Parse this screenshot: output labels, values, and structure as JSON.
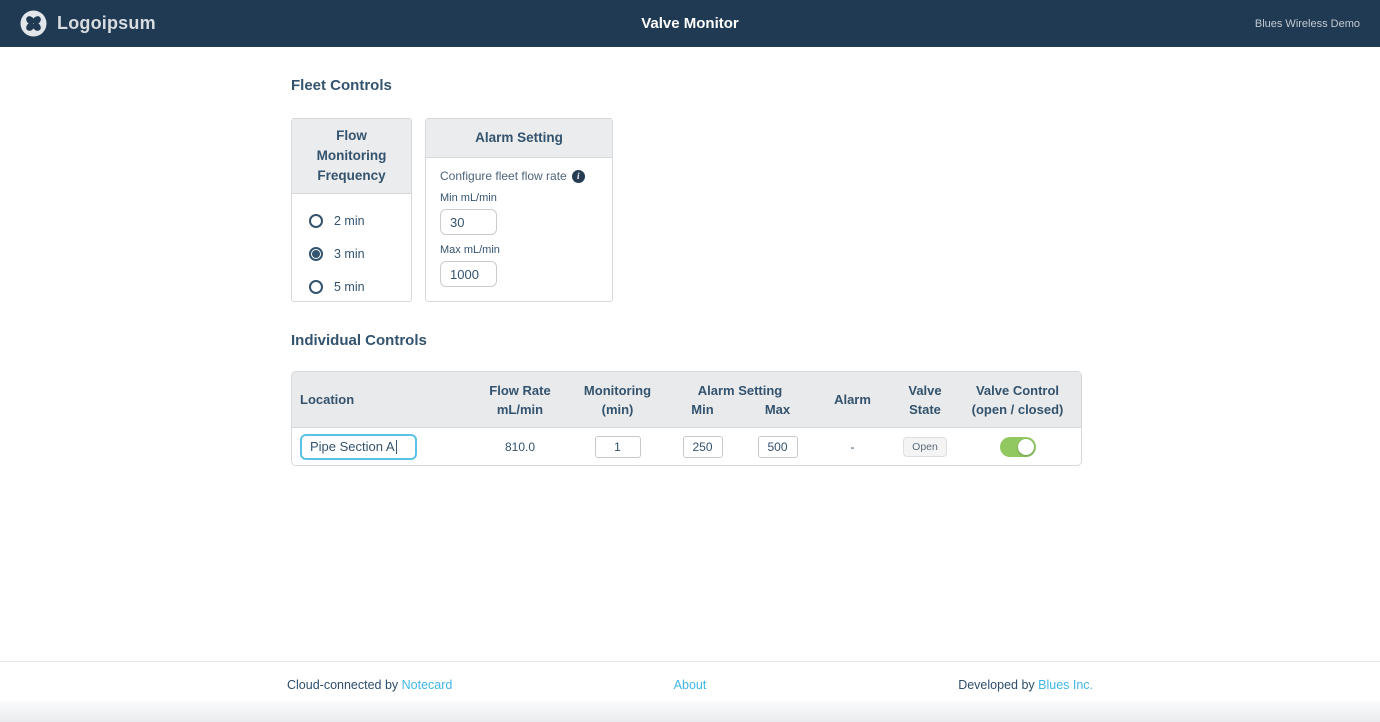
{
  "navbar": {
    "logo_text": "Logoipsum",
    "title": "Valve Monitor",
    "right_label": "Blues Wireless Demo"
  },
  "fleet_controls": {
    "heading": "Fleet Controls",
    "frequency_card": {
      "title": "Flow Monitoring Frequency",
      "options": [
        {
          "label": "2 min",
          "selected": false
        },
        {
          "label": "3 min",
          "selected": true
        },
        {
          "label": "5 min",
          "selected": false
        }
      ]
    },
    "alarm_card": {
      "title": "Alarm Setting",
      "description": "Configure fleet flow rate",
      "min_label": "Min mL/min",
      "min_value": "30",
      "max_label": "Max mL/min",
      "max_value": "1000"
    }
  },
  "individual_controls": {
    "heading": "Individual Controls",
    "table": {
      "headers": {
        "location": "Location",
        "flow_rate_line1": "Flow Rate",
        "flow_rate_line2": "mL/min",
        "monitoring_line1": "Monitoring",
        "monitoring_line2": "(min)",
        "alarm_setting_group": "Alarm Setting",
        "alarm_min": "Min",
        "alarm_max": "Max",
        "alarm": "Alarm",
        "valve_state_line1": "Valve",
        "valve_state_line2": "State",
        "valve_control_line1": "Valve Control",
        "valve_control_line2": "(open / closed)"
      },
      "rows": [
        {
          "location": "Pipe Section A",
          "flow_rate": "810.0",
          "monitoring": "1",
          "alarm_min": "250",
          "alarm_max": "500",
          "alarm": "-",
          "valve_state": "Open",
          "valve_control_on": true
        }
      ]
    }
  },
  "footer": {
    "left_prefix": "Cloud-connected by ",
    "left_link": "Notecard",
    "center_link": "About",
    "right_prefix": "Developed by ",
    "right_link": "Blues Inc."
  },
  "colors": {
    "navbar_bg": "#203A53",
    "text_navy": "#33536E",
    "link_blue": "#41B7E6",
    "input_focus_blue": "#5BC2E7",
    "toggle_green": "#92C860",
    "header_gray": "#E9EAEC"
  }
}
